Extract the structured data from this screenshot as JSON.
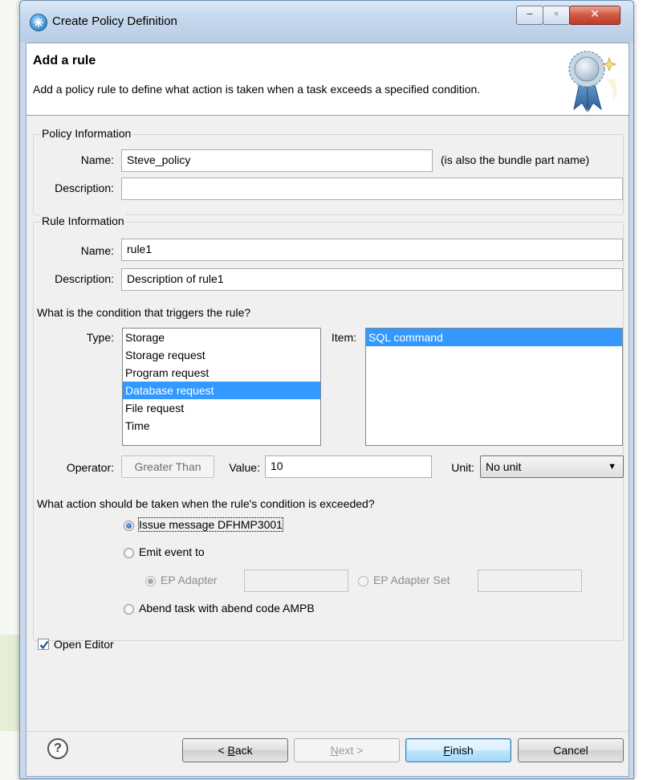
{
  "window": {
    "title": "Create Policy Definition",
    "controls": {
      "minimize": "–",
      "maximize": "▫",
      "close": "✕"
    }
  },
  "header": {
    "title": "Add a rule",
    "description": "Add a policy rule to define what action is taken when a task exceeds a specified condition."
  },
  "policy": {
    "legend": "Policy Information",
    "name_label": "Name:",
    "name_value": "Steve_policy",
    "name_hint": "(is also the bundle part name)",
    "description_label": "Description:",
    "description_value": ""
  },
  "rule": {
    "legend": "Rule Information",
    "name_label": "Name:",
    "name_value": "rule1",
    "description_label": "Description:",
    "description_value": "Description of rule1",
    "condition_question": "What is the condition that triggers the rule?",
    "type_label": "Type:",
    "types": [
      "Storage",
      "Storage request",
      "Program request",
      "Database request",
      "File request",
      "Time"
    ],
    "selected_type": "Database request",
    "item_label": "Item:",
    "items": [
      "SQL command"
    ],
    "selected_item": "SQL command",
    "operator_label": "Operator:",
    "operator_value": "Greater Than",
    "value_label": "Value:",
    "value_value": "10",
    "unit_label": "Unit:",
    "unit_value": "No unit",
    "action_question": "What action should be taken when the rule's condition is exceeded?",
    "actions": {
      "issue_message": "Issue message DFHMP3001",
      "emit_event": "Emit event to",
      "ep_adapter": "EP Adapter",
      "ep_adapter_set": "EP Adapter Set",
      "abend": "Abend task with abend code AMPB"
    },
    "selected_action": "issue_message"
  },
  "open_editor": {
    "label": "Open Editor",
    "checked": true
  },
  "buttons": {
    "help": "?",
    "back_prefix": "< ",
    "back_key": "B",
    "back_rest": "ack",
    "next_key": "N",
    "next_rest": "ext >",
    "finish_key": "F",
    "finish_rest": "inish",
    "cancel": "Cancel"
  },
  "colors": {
    "selection": "#3399ff",
    "titlebar": "#c5d7ec",
    "dialog_bg": "#f0f0f0"
  }
}
